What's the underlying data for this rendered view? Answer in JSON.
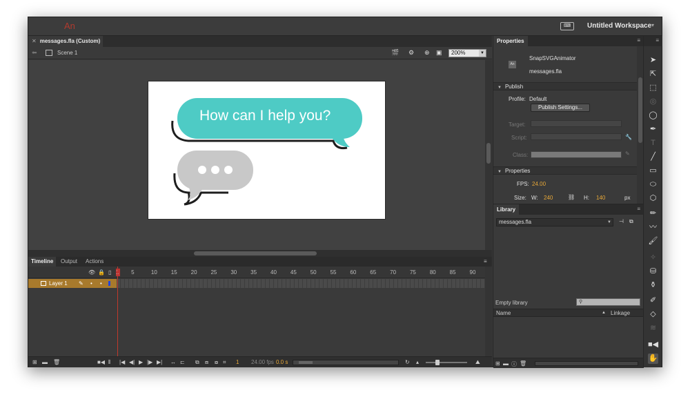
{
  "app": {
    "logo": "An",
    "workspace": "Untitled Workspace",
    "workspace_icon": "⌨"
  },
  "document": {
    "tab_title": "messages.fla (Custom)",
    "scene": "Scene 1",
    "zoom": "200%"
  },
  "stage": {
    "bubble_text": "How can I help you?",
    "colors": {
      "teal_bubble": "#4ecbc5",
      "grey_bubble": "#c8c8c8",
      "outline": "#1e1e1e",
      "stage_bg": "#ffffff"
    }
  },
  "timeline": {
    "tabs": [
      "Timeline",
      "Output",
      "Actions"
    ],
    "ruler": [
      "1",
      "5",
      "10",
      "15",
      "20",
      "25",
      "30",
      "35",
      "40",
      "45",
      "50",
      "55",
      "60",
      "65",
      "70",
      "75",
      "80",
      "85",
      "90"
    ],
    "layer": {
      "name": "Layer 1"
    },
    "footer": {
      "frame": "1",
      "fps": "24.00 fps",
      "time": "0.0 s"
    }
  },
  "properties": {
    "tab": "Properties",
    "doc_type": "SnapSVGAnimator",
    "doc_name": "messages.fla",
    "publish": {
      "section": "Publish",
      "profile_label": "Profile:",
      "profile_value": "Default",
      "settings_button": "Publish Settings...",
      "target_label": "Target:",
      "script_label": "Script:",
      "class_label": "Class:"
    },
    "props": {
      "section": "Properties",
      "fps_label": "FPS:",
      "fps_value": "24.00",
      "size_label": "Size:",
      "w_label": "W:",
      "w_value": "240",
      "h_label": "H:",
      "h_value": "140",
      "unit": "px"
    }
  },
  "library": {
    "tab": "Library",
    "selected": "messages.fla",
    "empty_text": "Empty library",
    "col_name": "Name",
    "col_linkage": "Linkage"
  },
  "tools": [
    "selection",
    "subselection",
    "free-transform",
    "3d-rotation",
    "lasso",
    "pen",
    "text",
    "line",
    "rectangle",
    "oval",
    "polystar",
    "pencil",
    "brush",
    "paint-brush",
    "bone",
    "paint-bucket",
    "ink-bottle",
    "eyedropper",
    "eraser",
    "width",
    "camera",
    "hand"
  ]
}
